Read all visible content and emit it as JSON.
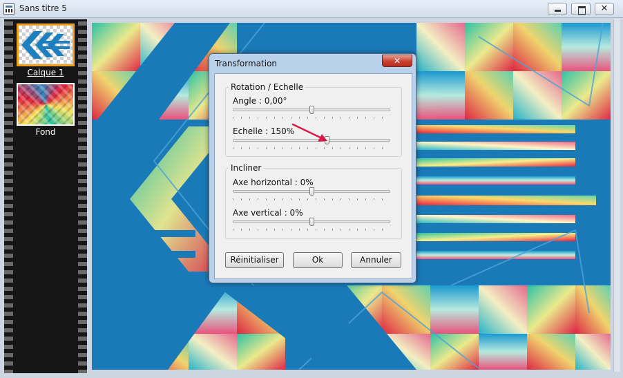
{
  "window": {
    "title": "Sans titre 5",
    "controls": {
      "close_glyph": "✕"
    }
  },
  "layers": [
    {
      "name": "Calque 1",
      "selected": true
    },
    {
      "name": "Fond",
      "selected": false
    }
  ],
  "dialog": {
    "title": "Transformation",
    "close_glyph": "✕",
    "groups": [
      {
        "title": "Rotation / Echelle",
        "sliders": [
          {
            "label": "Angle : 0,00°",
            "value_fraction": 0.5
          },
          {
            "label": "Echelle : 150%",
            "value_fraction": 0.6
          }
        ]
      },
      {
        "title": "Incliner",
        "sliders": [
          {
            "label": "Axe horizontal : 0%",
            "value_fraction": 0.5
          },
          {
            "label": "Axe vertical : 0%",
            "value_fraction": 0.5
          }
        ]
      }
    ],
    "buttons": {
      "reset": "Réinitialiser",
      "ok": "Ok",
      "cancel": "Annuler"
    }
  },
  "colors": {
    "canvas_blue": "#1a7ab8",
    "selection_border": "#f0a01e",
    "arrow": "#d81b4a",
    "dialog_frame": "#b9d1ea"
  },
  "icons": [
    "app-icon",
    "minimize-icon",
    "maximize-icon",
    "close-icon",
    "annotation-arrow-icon"
  ]
}
